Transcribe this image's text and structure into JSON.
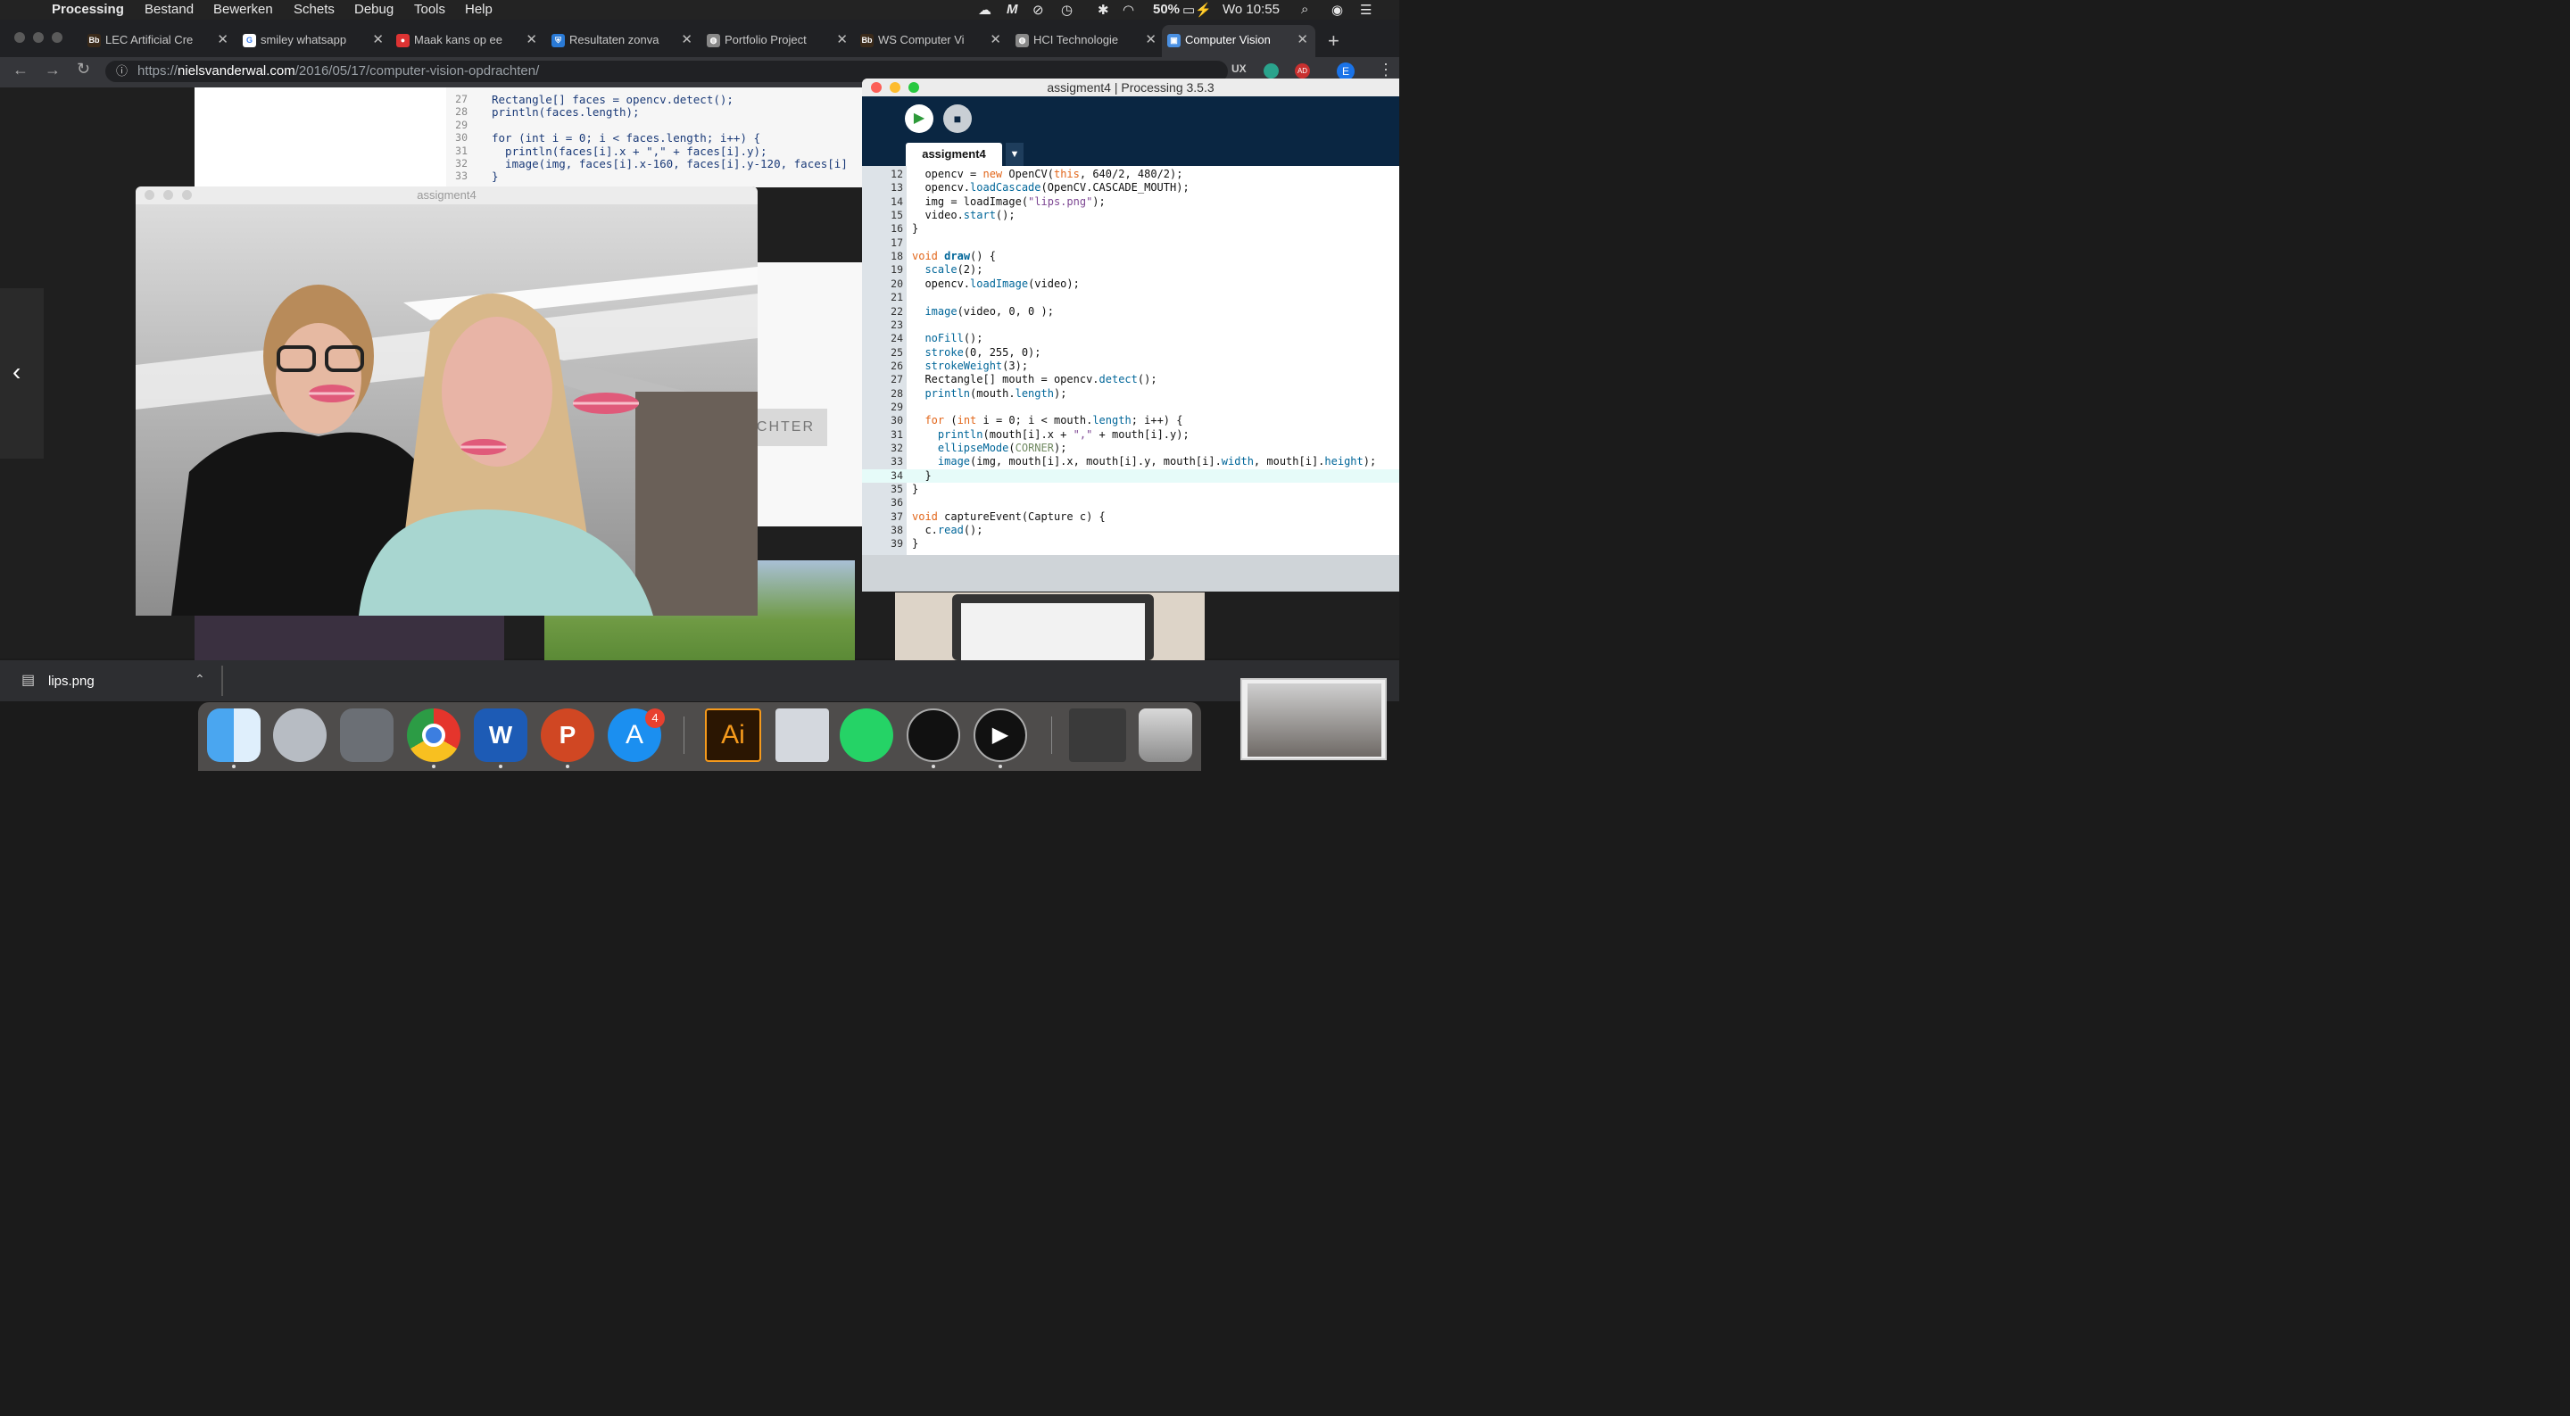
{
  "menubar": {
    "app": "Processing",
    "items": [
      "Bestand",
      "Bewerken",
      "Schets",
      "Debug",
      "Tools",
      "Help"
    ],
    "battery": "50%",
    "clock": "Wo 10:55"
  },
  "browser": {
    "tabs": [
      {
        "title": "LEC Artificial Cre",
        "icon": "bb-icon"
      },
      {
        "title": "smiley whatsapp",
        "icon": "google-icon"
      },
      {
        "title": "Maak kans op ee",
        "icon": "gift-icon"
      },
      {
        "title": "Resultaten zonva",
        "icon": "shield-icon"
      },
      {
        "title": "Portfolio Project",
        "icon": "globe-icon"
      },
      {
        "title": "WS Computer Vi",
        "icon": "bb-icon"
      },
      {
        "title": "HCI Technologie",
        "icon": "globe-icon"
      },
      {
        "title": "Computer Vision",
        "icon": "doc-icon"
      }
    ],
    "url_prefix": "https://",
    "url_host": "nielsvanderwal.com",
    "url_path": "/2016/05/17/computer-vision-opdrachten/",
    "page_button": "CHTER",
    "bg_code_lines": [
      {
        "n": "27",
        "text": "Rectangle[] faces = opencv.detect();"
      },
      {
        "n": "28",
        "text": "println(faces.length);"
      },
      {
        "n": "29",
        "text": ""
      },
      {
        "n": "30",
        "text": "for (int i = 0; i < faces.length; i++) {"
      },
      {
        "n": "31",
        "text": "  println(faces[i].x + \",\" + faces[i].y);"
      },
      {
        "n": "32",
        "text": "  image(img, faces[i].x-160, faces[i].y-120, faces[i]"
      },
      {
        "n": "33",
        "text": "}"
      }
    ]
  },
  "sketch_window": {
    "title": "assigment4"
  },
  "processing": {
    "title": "assigment4 | Processing 3.5.3",
    "tab": "assigment4",
    "lines": [
      {
        "n": "12",
        "text": "  opencv = new OpenCV(this, 640/2, 480/2);"
      },
      {
        "n": "13",
        "text": "  opencv.loadCascade(OpenCV.CASCADE_MOUTH);"
      },
      {
        "n": "14",
        "text": "  img = loadImage(\"lips.png\");"
      },
      {
        "n": "15",
        "text": "  video.start();"
      },
      {
        "n": "16",
        "text": "}"
      },
      {
        "n": "17",
        "text": ""
      },
      {
        "n": "18",
        "text": "void draw() {"
      },
      {
        "n": "19",
        "text": "  scale(2);"
      },
      {
        "n": "20",
        "text": "  opencv.loadImage(video);"
      },
      {
        "n": "21",
        "text": ""
      },
      {
        "n": "22",
        "text": "  image(video, 0, 0 );"
      },
      {
        "n": "23",
        "text": ""
      },
      {
        "n": "24",
        "text": "  noFill();"
      },
      {
        "n": "25",
        "text": "  stroke(0, 255, 0);"
      },
      {
        "n": "26",
        "text": "  strokeWeight(3);"
      },
      {
        "n": "27",
        "text": "  Rectangle[] mouth = opencv.detect();"
      },
      {
        "n": "28",
        "text": "  println(mouth.length);"
      },
      {
        "n": "29",
        "text": ""
      },
      {
        "n": "30",
        "text": "  for (int i = 0; i < mouth.length; i++) {"
      },
      {
        "n": "31",
        "text": "    println(mouth[i].x + \",\" + mouth[i].y);"
      },
      {
        "n": "32",
        "text": "    ellipseMode(CORNER);"
      },
      {
        "n": "33",
        "text": "    image(img, mouth[i].x, mouth[i].y, mouth[i].width, mouth[i].height);"
      },
      {
        "n": "34",
        "text": "  }"
      },
      {
        "n": "35",
        "text": "}"
      },
      {
        "n": "36",
        "text": ""
      },
      {
        "n": "37",
        "text": "void captureEvent(Capture c) {"
      },
      {
        "n": "38",
        "text": "  c.read();"
      },
      {
        "n": "39",
        "text": "}"
      }
    ]
  },
  "downloads": {
    "file": "lips.png"
  },
  "dock": {
    "badge_appstore": "4",
    "apps": [
      "finder-icon",
      "launchpad-icon",
      "system-preferences-icon",
      "chrome-icon",
      "word-icon",
      "powerpoint-icon",
      "app-store-icon",
      "illustrator-icon",
      "xcode-tools-icon",
      "whatsapp-icon",
      "processing-icon",
      "final-cut-icon",
      "preview-window-icon",
      "trash-icon"
    ],
    "illustrator_label": "Ai",
    "word_label": "W",
    "powerpoint_label": "P"
  },
  "colors": {
    "processing_dark": "#0a2642",
    "chrome_dark": "#202124",
    "code_keyword": "#e2661a",
    "code_function": "#006699"
  }
}
